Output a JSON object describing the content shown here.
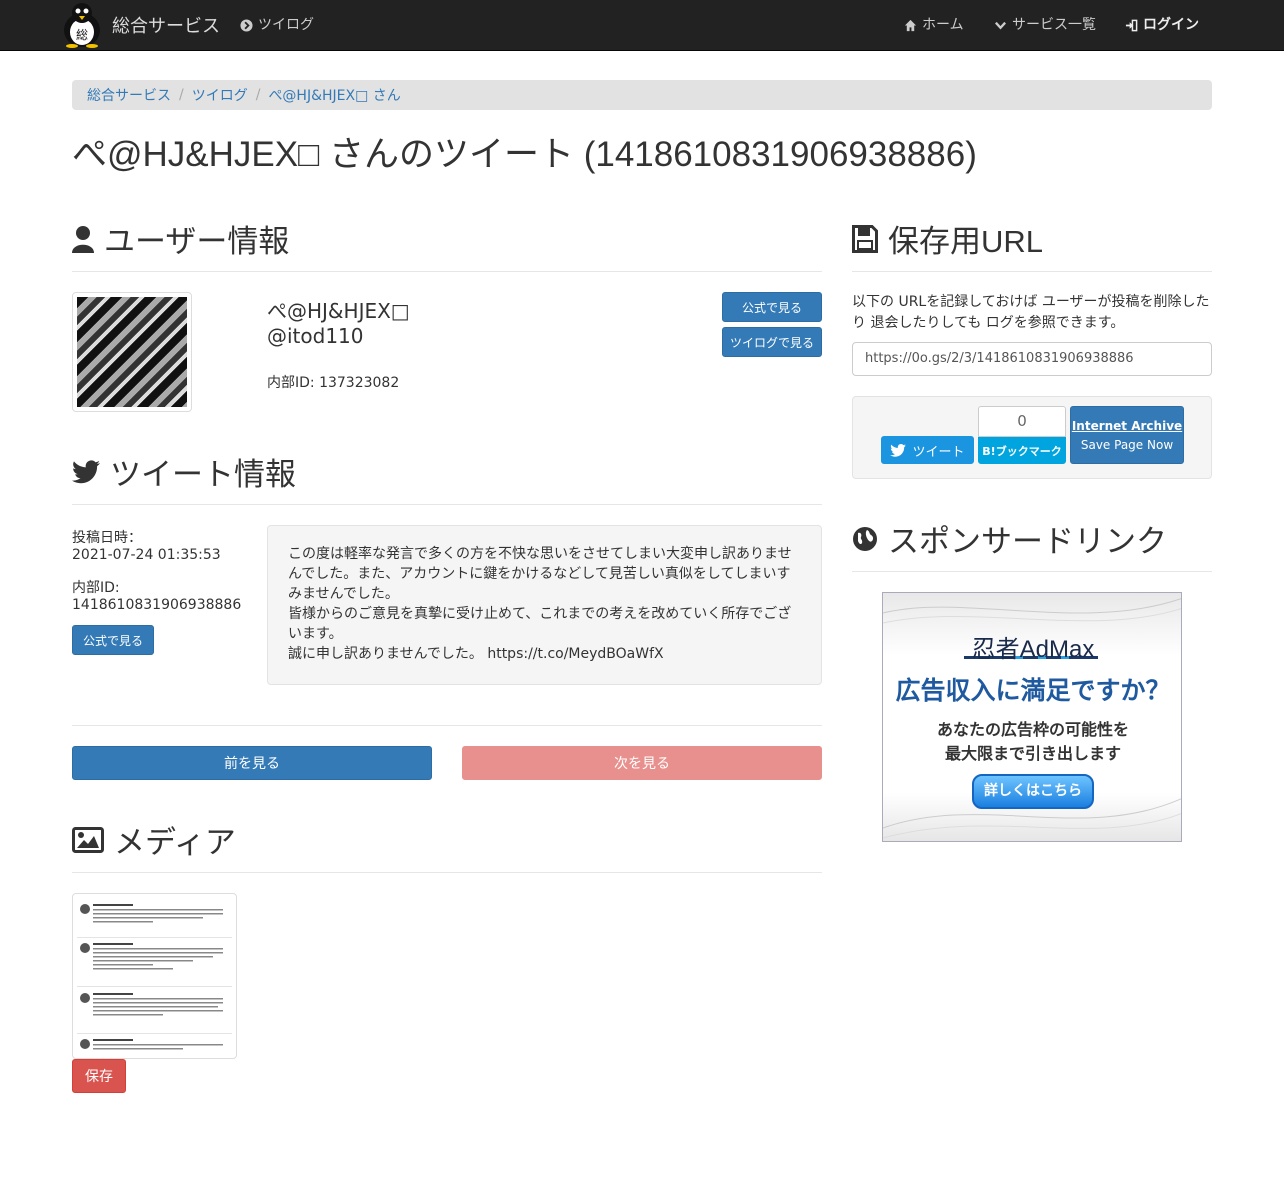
{
  "navbar": {
    "brand": "総合サービス",
    "brand_logo_char": "総",
    "twilog_link": "ツイログ",
    "home": "ホーム",
    "services": "サービス一覧",
    "login": "ログイン"
  },
  "breadcrumb": [
    "総合サービス",
    "ツイログ",
    "ぺ@HJ&HJEX□ さん"
  ],
  "page_title": "ぺ@HJ&HJEX□ さんのツイート (1418610831906938886)",
  "user_section": {
    "heading": "ユーザー情報",
    "display_name": "ぺ@HJ&HJEX□",
    "screen_name": "@itod110",
    "internal_id": "内部ID: 137323082",
    "official_button": "公式で見る",
    "twilog_button": "ツイログで見る"
  },
  "tweet_section": {
    "heading": "ツイート情報",
    "posted_label": "投稿日時：",
    "posted_value": "2021-07-24 01:35:53",
    "id_label": "内部ID:",
    "id_value": "1418610831906938886",
    "official_button": "公式で見る",
    "text": "この度は軽率な発言で多くの方を不快な思いをさせてしまい大変申し訳ありませんでした。また、アカウントに鍵をかけるなどして見苦しい真似をしてしまいすみませんでした。\n皆様からのご意見を真摯に受け止めて、これまでの考えを改めていく所存でございます。\n誠に申し訳ありませんでした。 https://t.co/MeydBOaWfX"
  },
  "pager": {
    "prev": "前を見る",
    "next": "次を見る"
  },
  "media_section": {
    "heading": "メディア",
    "save_button": "保存"
  },
  "save_url_section": {
    "heading": "保存用URL",
    "description": "以下の URLを記録しておけば ユーザーが投稿を削除したり 退会したりしても ログを参照できます。",
    "url": "https://0o.gs/2/3/1418610831906938886"
  },
  "share": {
    "tweet_button": "ツイート",
    "bookmark_count": "0",
    "bookmark_label": "B!ブックマーク",
    "archive_title": "Internet Archive",
    "archive_action": "Save Page Now"
  },
  "sponsor_section": {
    "heading": "スポンサードリンク",
    "ad_brand": "忍者AdMax",
    "ad_headline": "広告収入に満足ですか？",
    "ad_line1": "あなたの広告枠の可能性を",
    "ad_line2": "最大限まで引き出します",
    "ad_cta": "詳しくはこちら"
  },
  "colors": {
    "navbar_bg": "#222222",
    "primary": "#337ab7",
    "danger": "#d9534f",
    "twitter": "#1b95e0",
    "hatena": "#00a4de"
  }
}
